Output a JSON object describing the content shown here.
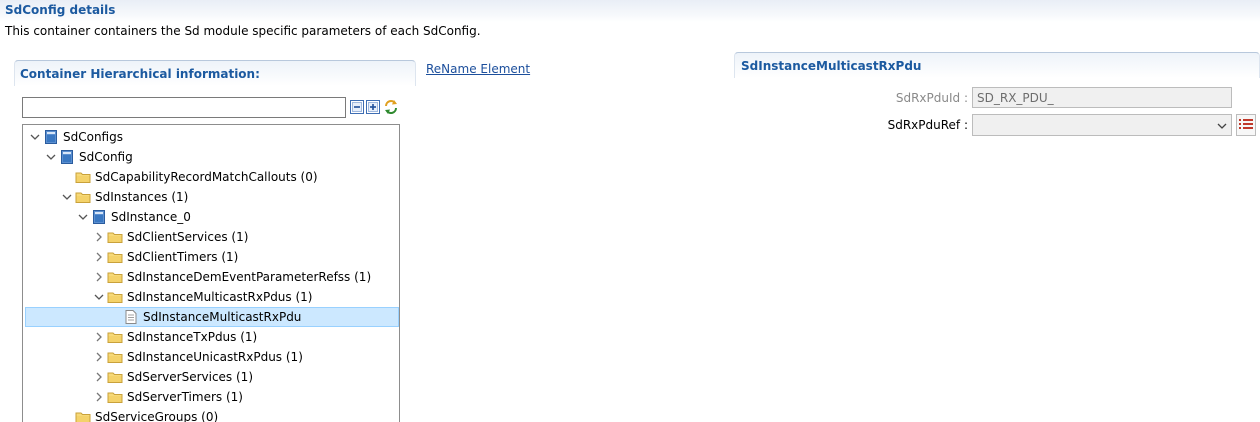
{
  "page": {
    "title": "SdConfig details",
    "description": "This container containers the Sd module specific parameters of each SdConfig."
  },
  "hierarchy": {
    "title": "Container Hierarchical information:",
    "rename_link": "ReName Element",
    "filter_value": "",
    "toolbar": [
      "collapse-all-icon",
      "expand-all-icon",
      "sync-icon"
    ]
  },
  "tree": [
    {
      "label": "SdConfigs",
      "icon": "module-icon",
      "twisty": "expanded"
    },
    {
      "label": "SdConfig",
      "icon": "module-icon",
      "twisty": "expanded"
    },
    {
      "label": "SdCapabilityRecordMatchCallouts (0)",
      "icon": "folder-icon",
      "twisty": "none"
    },
    {
      "label": "SdInstances (1)",
      "icon": "folder-icon",
      "twisty": "expanded"
    },
    {
      "label": "SdInstance_0",
      "icon": "module-icon",
      "twisty": "expanded"
    },
    {
      "label": "SdClientServices (1)",
      "icon": "folder-icon",
      "twisty": "collapsed"
    },
    {
      "label": "SdClientTimers (1)",
      "icon": "folder-icon",
      "twisty": "collapsed"
    },
    {
      "label": "SdInstanceDemEventParameterRefss (1)",
      "icon": "folder-icon",
      "twisty": "collapsed"
    },
    {
      "label": "SdInstanceMulticastRxPdus (1)",
      "icon": "folder-icon",
      "twisty": "expanded"
    },
    {
      "label": "SdInstanceMulticastRxPdu",
      "icon": "document-icon",
      "twisty": "none",
      "selected": true
    },
    {
      "label": "SdInstanceTxPdus (1)",
      "icon": "folder-icon",
      "twisty": "collapsed"
    },
    {
      "label": "SdInstanceUnicastRxPdus (1)",
      "icon": "folder-icon",
      "twisty": "collapsed"
    },
    {
      "label": "SdServerServices (1)",
      "icon": "folder-icon",
      "twisty": "collapsed"
    },
    {
      "label": "SdServerTimers (1)",
      "icon": "folder-icon",
      "twisty": "collapsed"
    },
    {
      "label": "SdServiceGroups (0)",
      "icon": "folder-icon",
      "twisty": "none"
    }
  ],
  "details": {
    "title": "SdInstanceMulticastRxPdu",
    "fields": {
      "rx_pdu_id": {
        "label": "SdRxPduId :",
        "value": "SD_RX_PDU_"
      },
      "rx_pdu_ref": {
        "label": "SdRxPduRef :",
        "value": ""
      }
    }
  },
  "colors": {
    "title_blue": "#1c5aa0",
    "selection_bg": "#cce8ff",
    "folder_yellow": "#f4d26a",
    "module_blue": "#3a78c2"
  }
}
